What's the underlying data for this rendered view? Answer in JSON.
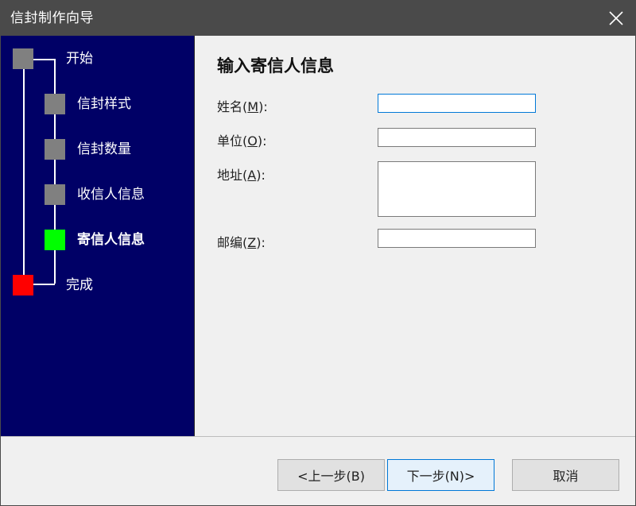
{
  "window": {
    "title": "信封制作向导"
  },
  "wizard_steps": [
    {
      "label": "开始",
      "state": "done",
      "color": "#808080"
    },
    {
      "label": "信封样式",
      "state": "done",
      "color": "#808080"
    },
    {
      "label": "信封数量",
      "state": "done",
      "color": "#808080"
    },
    {
      "label": "收信人信息",
      "state": "done",
      "color": "#808080"
    },
    {
      "label": "寄信人信息",
      "state": "current",
      "color": "#00ff00"
    },
    {
      "label": "完成",
      "state": "end",
      "color": "#ff0000"
    }
  ],
  "form": {
    "heading": "输入寄信人信息",
    "fields": [
      {
        "label": "姓名",
        "access_key": "M",
        "value": ""
      },
      {
        "label": "单位",
        "access_key": "O",
        "value": ""
      },
      {
        "label": "地址",
        "access_key": "A",
        "value": ""
      },
      {
        "label": "邮编",
        "access_key": "Z",
        "value": ""
      }
    ]
  },
  "buttons": {
    "back": "<上一步(B)",
    "next": "下一步(N)>",
    "cancel": "取消"
  },
  "colors": {
    "titlebar": "#4a4a4a",
    "sidebar": "#000066",
    "current_step": "#00ff00",
    "finish_step": "#ff0000",
    "inactive_step": "#808080",
    "focus_border": "#0078d7"
  },
  "icons": {
    "close": "close-icon"
  }
}
